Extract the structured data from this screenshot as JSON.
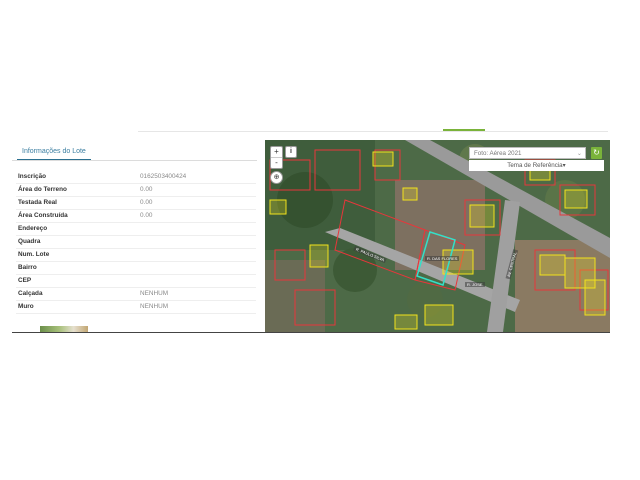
{
  "header": {
    "accent_color": "#7ab33a"
  },
  "panel": {
    "tab_label": "Informações do Lote",
    "rows": [
      {
        "label": "Inscrição",
        "value": "0162503400424"
      },
      {
        "label": "Área do Terreno",
        "value": "0.00"
      },
      {
        "label": "Testada Real",
        "value": "0.00"
      },
      {
        "label": "Área Construída",
        "value": "0.00"
      },
      {
        "label": "Endereço",
        "value": ""
      },
      {
        "label": "Quadra",
        "value": ""
      },
      {
        "label": "Num. Lote",
        "value": ""
      },
      {
        "label": "Bairro",
        "value": ""
      },
      {
        "label": "CEP",
        "value": ""
      },
      {
        "label": "Calçada",
        "value": "NENHUM"
      },
      {
        "label": "Muro",
        "value": "NENHUM"
      }
    ]
  },
  "map": {
    "zoom_in": "+",
    "zoom_out": "-",
    "info_icon": "info-icon",
    "locate_icon": "crosshair-icon",
    "layer_selected": "Foto: Aérea 2021",
    "reference_label": "Tema de Referência▾",
    "refresh_icon": "refresh-icon",
    "street_labels": [
      "R. PAULO SILVA",
      "R. DAS FLORES",
      "AV. CENTRAL",
      "R. JOSE"
    ],
    "colors": {
      "lot_outline": "#e8363b",
      "building_outline": "#f2e21b",
      "selected_lot": "#33e0c8",
      "road": "#9a9a9a"
    }
  }
}
